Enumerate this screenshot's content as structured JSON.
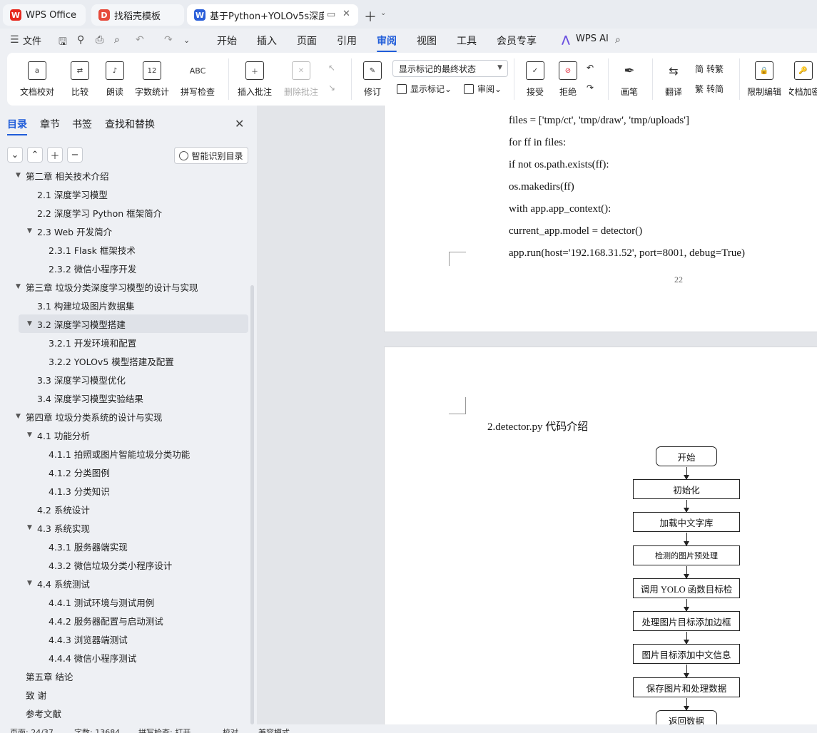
{
  "tabs": [
    {
      "label": "WPS Office",
      "icon": "wps-logo-icon",
      "color": "#e6281e"
    },
    {
      "label": "找稻壳模板",
      "icon": "docer-icon",
      "color": "#e64a3b"
    },
    {
      "label": "基于Python+YOLOv5s深度学",
      "icon": "wps-writer-icon",
      "color": "#2b5fd9"
    }
  ],
  "menu": {
    "file": "文件",
    "items": [
      "开始",
      "插入",
      "页面",
      "引用",
      "审阅",
      "视图",
      "工具",
      "会员专享"
    ],
    "active": "审阅",
    "wps_ai": "WPS AI"
  },
  "ribbon": {
    "doc_proof": "文档校对",
    "compare": "比较",
    "read_aloud": "朗读",
    "word_count": "字数统计",
    "spell_check": "拼写检查",
    "insert_comment": "插入批注",
    "delete_comment": "删除批注",
    "revise": "修订",
    "markup_state": "显示标记的最终状态",
    "show_markup": "显示标记",
    "review_pane": "审阅",
    "accept": "接受",
    "reject": "拒绝",
    "pen": "画笔",
    "translate": "翻译",
    "to_traditional": "转繁",
    "to_simplified": "转简",
    "restrict_edit": "限制编辑",
    "doc_encrypt": "文档加密"
  },
  "nav": {
    "tabs": [
      "目录",
      "章节",
      "书签",
      "查找和替换"
    ],
    "active_tab": "目录",
    "smart_toc": "智能识别目录",
    "toc": [
      {
        "level": 0,
        "text": "第二章  相关技术介绍",
        "arrow": true
      },
      {
        "level": 1,
        "text": "2.1   深度学习模型"
      },
      {
        "level": 1,
        "text": "2.2   深度学习 Python 框架简介"
      },
      {
        "level": 1,
        "text": "2.3   Web 开发简介",
        "arrow": true
      },
      {
        "level": 2,
        "text": "2.3.1    Flask 框架技术"
      },
      {
        "level": 2,
        "text": "2.3.2    微信小程序开发"
      },
      {
        "level": 0,
        "text": "第三章  垃圾分类深度学习模型的设计与实现",
        "arrow": true
      },
      {
        "level": 1,
        "text": "3.1   构建垃圾图片数据集"
      },
      {
        "level": 1,
        "text": "3.2   深度学习模型搭建",
        "arrow": true,
        "selected": true
      },
      {
        "level": 2,
        "text": "3.2.1    开发环境和配置"
      },
      {
        "level": 2,
        "text": "3.2.2    YOLOv5 模型搭建及配置"
      },
      {
        "level": 1,
        "text": "3.3   深度学习模型优化"
      },
      {
        "level": 1,
        "text": "3.4   深度学习模型实验结果"
      },
      {
        "level": 0,
        "text": "第四章   垃圾分类系统的设计与实现",
        "arrow": true
      },
      {
        "level": 1,
        "text": "4.1   功能分析",
        "arrow": true
      },
      {
        "level": 2,
        "text": "4.1.1    拍照或图片智能垃圾分类功能"
      },
      {
        "level": 2,
        "text": "4.1.2    分类图例"
      },
      {
        "level": 2,
        "text": "4.1.3    分类知识"
      },
      {
        "level": 1,
        "text": "4.2   系统设计"
      },
      {
        "level": 1,
        "text": "4.3   系统实现",
        "arrow": true
      },
      {
        "level": 2,
        "text": "4.3.1    服务器端实现"
      },
      {
        "level": 2,
        "text": "4.3.2    微信垃圾分类小程序设计"
      },
      {
        "level": 1,
        "text": "4.4   系统测试",
        "arrow": true
      },
      {
        "level": 2,
        "text": "4.4.1    测试环境与测试用例"
      },
      {
        "level": 2,
        "text": "4.4.2    服务器配置与启动测试"
      },
      {
        "level": 2,
        "text": "4.4.3    浏览器端测试"
      },
      {
        "level": 2,
        "text": "4.4.4    微信小程序测试"
      },
      {
        "level": 0,
        "text": "第五章   结论"
      },
      {
        "level": 0,
        "text": "致      谢"
      },
      {
        "level": 0,
        "text": "参考文献"
      }
    ]
  },
  "document": {
    "code_lines": [
      "files = ['tmp/ct', 'tmp/draw', 'tmp/uploads']",
      "for ff in  files:",
      "        if not os.path.exists(ff):",
      "                os.makedirs(ff)",
      "with app.app_context():",
      "        current_app.model = detector()",
      "app.run(host='192.168.31.52', port=8001, debug=True)"
    ],
    "page_number": "22",
    "section_heading": "2.detector.py 代码介绍",
    "flowchart": [
      "开始",
      "初始化",
      "加载中文字库",
      "检测的图片预处理",
      "调用 YOLO 函数目标检",
      "处理图片目标添加边框",
      "图片目标添加中文信息",
      "保存图片和处理数据",
      "返回数据"
    ]
  },
  "status": {
    "page": "页面: 24/37",
    "words": "字数: 13684",
    "spell": "拼写检查: 打开",
    "proof": "校对",
    "compat": "兼容模式"
  }
}
